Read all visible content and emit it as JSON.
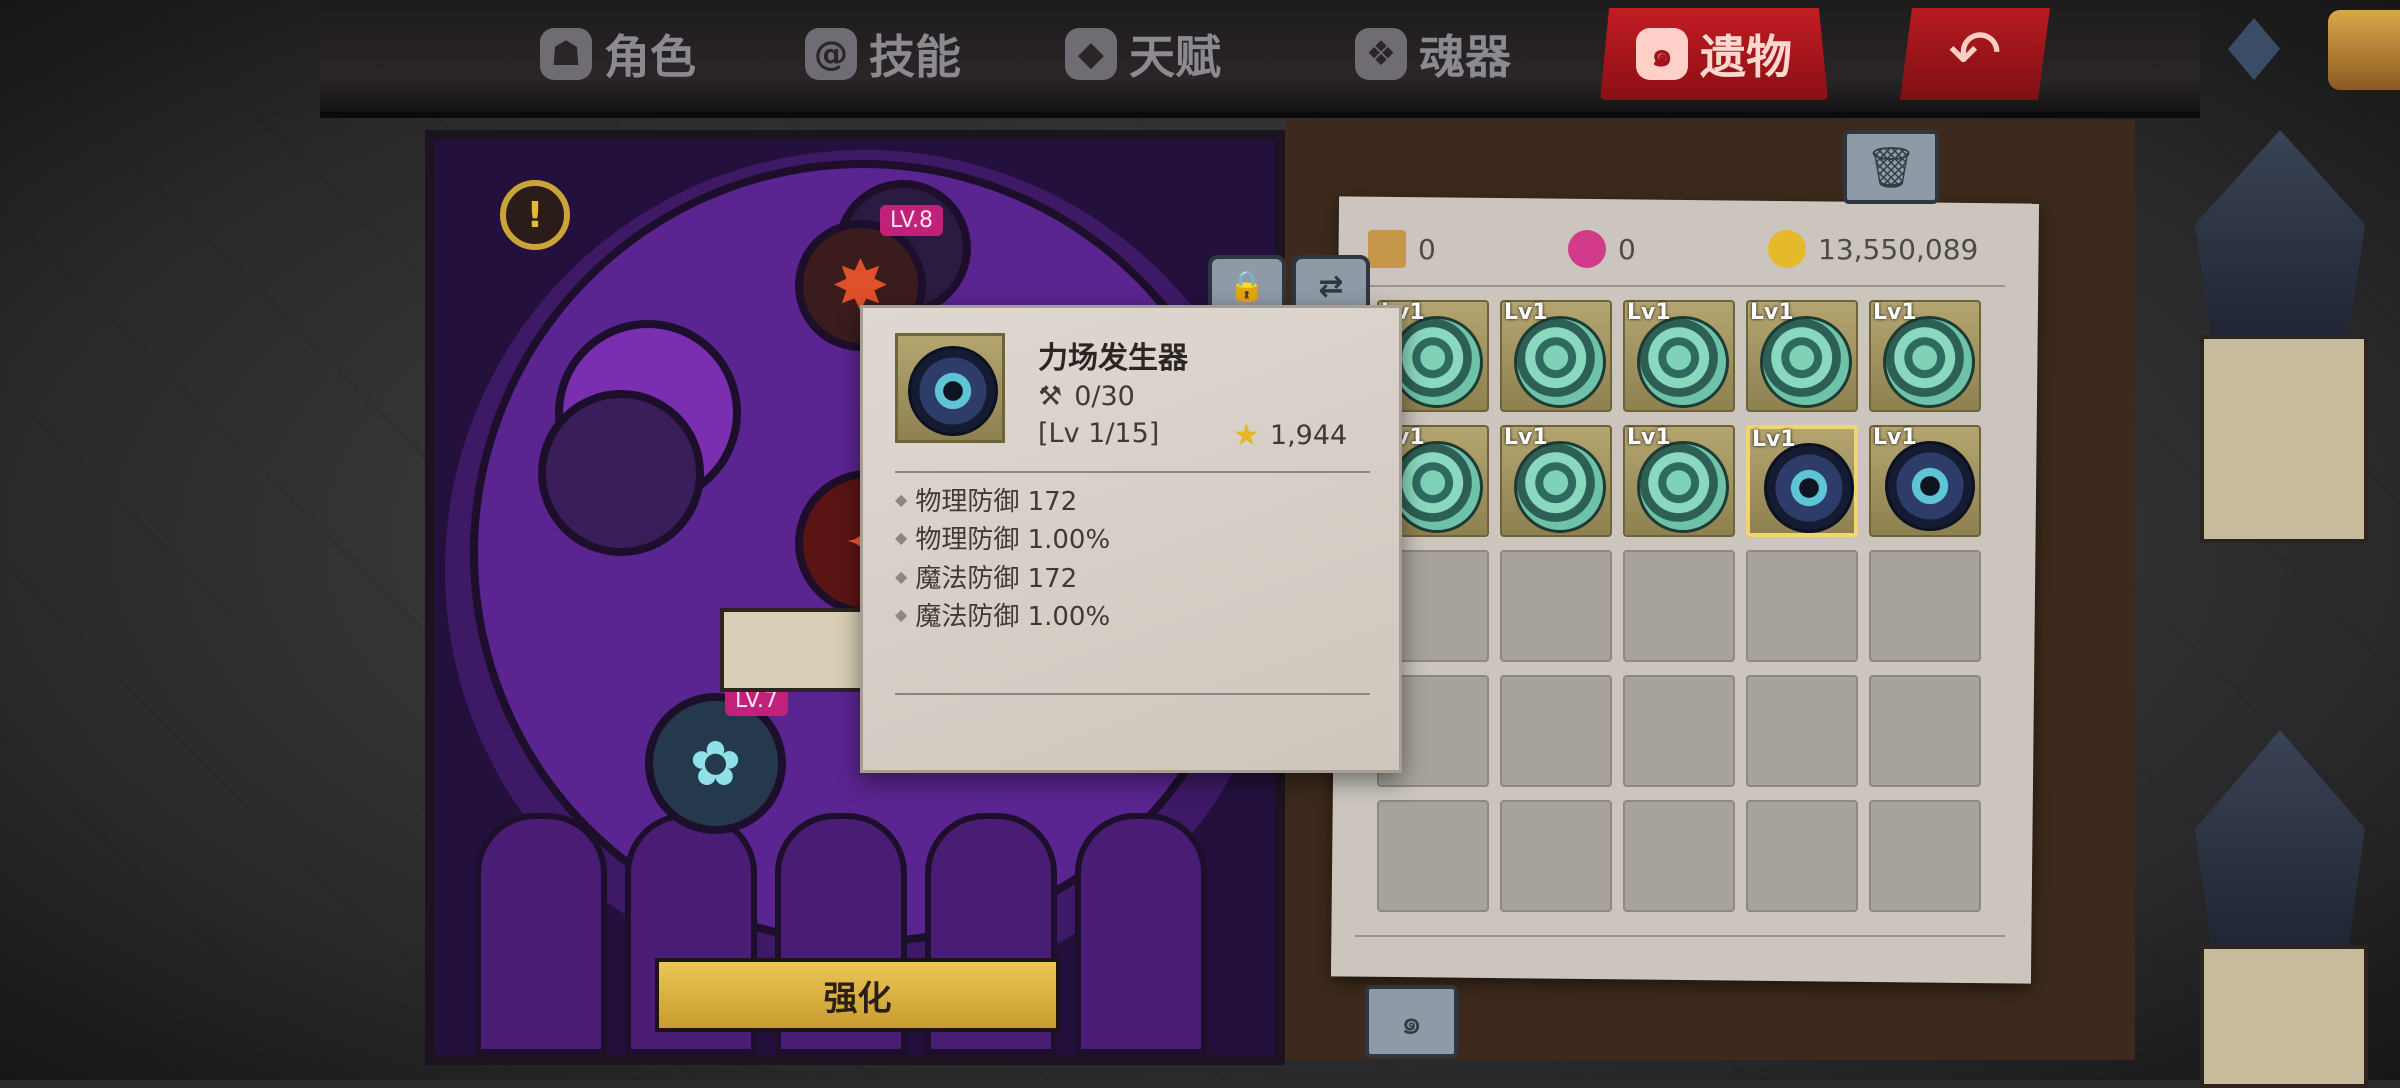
{
  "tabs": [
    {
      "label": "角色",
      "icon": "helmet-icon"
    },
    {
      "label": "技能",
      "icon": "skill-swirl-icon"
    },
    {
      "label": "天赋",
      "icon": "talent-icon"
    },
    {
      "label": "魂器",
      "icon": "soul-vessel-icon"
    },
    {
      "label": "遗物",
      "icon": "relic-icon",
      "active": true
    }
  ],
  "left_panel": {
    "slots": [
      {
        "level": "LV.8"
      },
      {
        "level": "LV.7"
      }
    ],
    "enhance_label": "强化"
  },
  "resources": [
    {
      "icon": "hourglass-icon",
      "value": "0"
    },
    {
      "icon": "potion-icon",
      "value": "0"
    },
    {
      "icon": "gold-coin-icon",
      "value": "13,550,089"
    }
  ],
  "inventory": {
    "rows": [
      [
        {
          "level": "Lv1",
          "relic": "swirl"
        },
        {
          "level": "Lv1",
          "relic": "swirl"
        },
        {
          "level": "Lv1",
          "relic": "swirl"
        },
        {
          "level": "Lv1",
          "relic": "swirl"
        },
        {
          "level": "Lv1",
          "relic": "swirl"
        }
      ],
      [
        {
          "level": "Lv1",
          "relic": "swirl"
        },
        {
          "level": "Lv1",
          "relic": "swirl"
        },
        {
          "level": "Lv1",
          "relic": "swirl"
        },
        {
          "level": "Lv1",
          "relic": "gear",
          "selected": true
        },
        {
          "level": "Lv1",
          "relic": "gear"
        }
      ]
    ],
    "empty_rows": 3
  },
  "tooltip": {
    "name": "力场发生器",
    "durability": "0/30",
    "level": "[Lv 1/15]",
    "score": "1,944",
    "stats": [
      "物理防御 172",
      "物理防御 1.00%",
      "魔法防御 172",
      "魔法防御 1.00%"
    ]
  },
  "colors": {
    "active_tab": "#c21d23",
    "enhance_button": "#e1bb4a",
    "level_badge": "#c2217a",
    "selected_cell": "#f1d66e"
  }
}
